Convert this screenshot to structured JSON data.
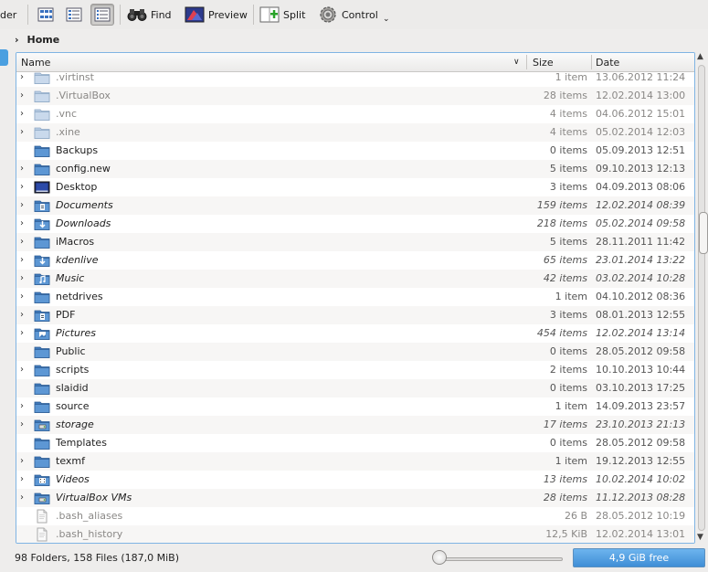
{
  "toolbar": {
    "cut_label": "der",
    "find_label": "Find",
    "preview_label": "Preview",
    "split_label": "Split",
    "control_label": "Control",
    "icons": [
      "icons-view-icon",
      "compact-view-icon",
      "details-view-icon",
      "binoculars-icon",
      "preview-icon",
      "split-icon",
      "gear-icon",
      "chevron-down-icon"
    ]
  },
  "breadcrumb": {
    "label": "Home"
  },
  "columns": {
    "name": "Name",
    "size": "Size",
    "date": "Date"
  },
  "rows": [
    {
      "name": ".virtinst",
      "size": "1 item",
      "date": "13.06.2012 11:24",
      "kind": "folder",
      "hidden": true,
      "link": false,
      "expandable": true
    },
    {
      "name": ".VirtualBox",
      "size": "28 items",
      "date": "12.02.2014 13:00",
      "kind": "folder",
      "hidden": true,
      "link": false,
      "expandable": true
    },
    {
      "name": ".vnc",
      "size": "4 items",
      "date": "04.06.2012 15:01",
      "kind": "folder",
      "hidden": true,
      "link": false,
      "expandable": true
    },
    {
      "name": ".xine",
      "size": "4 items",
      "date": "05.02.2014 12:03",
      "kind": "folder",
      "hidden": true,
      "link": false,
      "expandable": true
    },
    {
      "name": "Backups",
      "size": "0 items",
      "date": "05.09.2013 12:51",
      "kind": "folder",
      "hidden": false,
      "link": false,
      "expandable": false
    },
    {
      "name": "config.new",
      "size": "5 items",
      "date": "09.10.2013 12:13",
      "kind": "folder",
      "hidden": false,
      "link": false,
      "expandable": true
    },
    {
      "name": "Desktop",
      "size": "3 items",
      "date": "04.09.2013 08:06",
      "kind": "desktop",
      "hidden": false,
      "link": false,
      "expandable": true
    },
    {
      "name": "Documents",
      "size": "159 items",
      "date": "12.02.2014 08:39",
      "kind": "docs",
      "hidden": false,
      "link": true,
      "expandable": true
    },
    {
      "name": "Downloads",
      "size": "218 items",
      "date": "05.02.2014 09:58",
      "kind": "download",
      "hidden": false,
      "link": true,
      "expandable": true
    },
    {
      "name": "iMacros",
      "size": "5 items",
      "date": "28.11.2011 11:42",
      "kind": "folder",
      "hidden": false,
      "link": false,
      "expandable": true
    },
    {
      "name": "kdenlive",
      "size": "65 items",
      "date": "23.01.2014 13:22",
      "kind": "download",
      "hidden": false,
      "link": true,
      "expandable": true
    },
    {
      "name": "Music",
      "size": "42 items",
      "date": "03.02.2014 10:28",
      "kind": "music",
      "hidden": false,
      "link": true,
      "expandable": true
    },
    {
      "name": "netdrives",
      "size": "1 item",
      "date": "04.10.2012 08:36",
      "kind": "folder",
      "hidden": false,
      "link": false,
      "expandable": true
    },
    {
      "name": "PDF",
      "size": "3 items",
      "date": "08.01.2013 12:55",
      "kind": "docs",
      "hidden": false,
      "link": false,
      "expandable": true
    },
    {
      "name": "Pictures",
      "size": "454 items",
      "date": "12.02.2014 13:14",
      "kind": "pictures",
      "hidden": false,
      "link": true,
      "expandable": true
    },
    {
      "name": "Public",
      "size": "0 items",
      "date": "28.05.2012 09:58",
      "kind": "folder",
      "hidden": false,
      "link": false,
      "expandable": false
    },
    {
      "name": "scripts",
      "size": "2 items",
      "date": "10.10.2013 10:44",
      "kind": "folder",
      "hidden": false,
      "link": false,
      "expandable": true
    },
    {
      "name": "slaidid",
      "size": "0 items",
      "date": "03.10.2013 17:25",
      "kind": "folder",
      "hidden": false,
      "link": false,
      "expandable": false
    },
    {
      "name": "source",
      "size": "1 item",
      "date": "14.09.2013 23:57",
      "kind": "folder",
      "hidden": false,
      "link": false,
      "expandable": true
    },
    {
      "name": "storage",
      "size": "17 items",
      "date": "23.10.2013 21:13",
      "kind": "drive",
      "hidden": false,
      "link": true,
      "expandable": true
    },
    {
      "name": "Templates",
      "size": "0 items",
      "date": "28.05.2012 09:58",
      "kind": "folder",
      "hidden": false,
      "link": false,
      "expandable": false
    },
    {
      "name": "texmf",
      "size": "1 item",
      "date": "19.12.2013 12:55",
      "kind": "folder",
      "hidden": false,
      "link": false,
      "expandable": true
    },
    {
      "name": "Videos",
      "size": "13 items",
      "date": "10.02.2014 10:02",
      "kind": "video",
      "hidden": false,
      "link": true,
      "expandable": true
    },
    {
      "name": "VirtualBox VMs",
      "size": "28 items",
      "date": "11.12.2013 08:28",
      "kind": "drive",
      "hidden": false,
      "link": true,
      "expandable": true
    },
    {
      "name": ".bash_aliases",
      "size": "26 B",
      "date": "28.05.2012 10:19",
      "kind": "file",
      "hidden": true,
      "link": false,
      "expandable": false
    },
    {
      "name": ".bash_history",
      "size": "12,5 KiB",
      "date": "12.02.2014 13:01",
      "kind": "file",
      "hidden": true,
      "link": false,
      "expandable": false
    }
  ],
  "status": {
    "summary": "98 Folders, 158 Files (187,0 MiB)",
    "free_space": "4,9 GiB free"
  },
  "colors": {
    "accent": "#3f8ed6",
    "folder": "#5d97d4",
    "frame": "#7fb4e3"
  }
}
